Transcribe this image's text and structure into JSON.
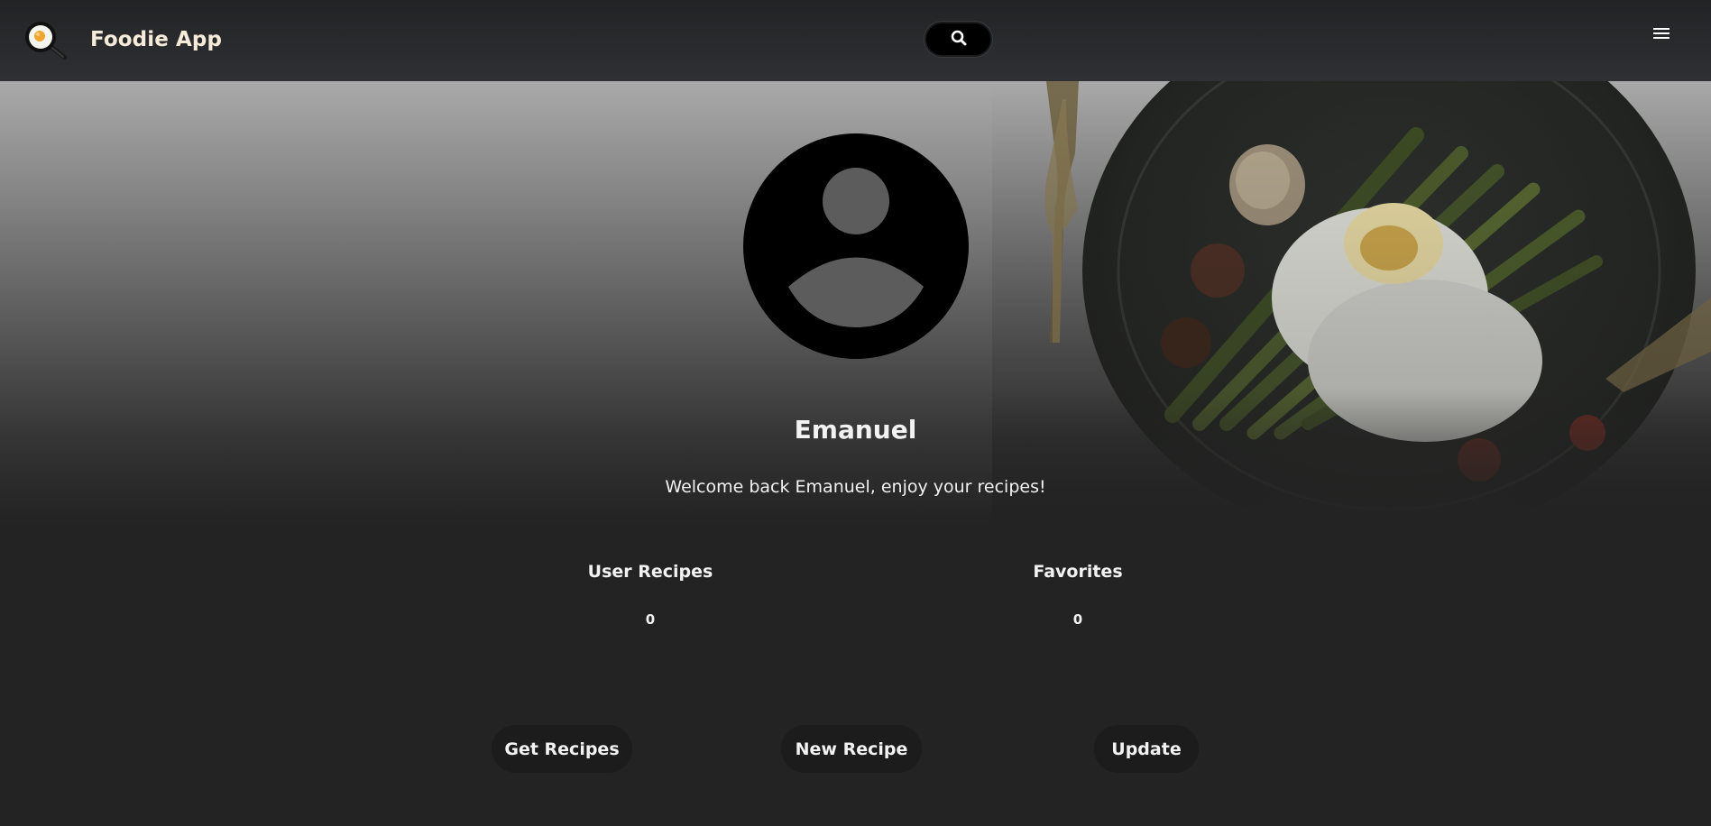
{
  "navbar": {
    "brand": "Foodie App",
    "logo_icon": "frying-pan-egg-icon",
    "search_icon": "search-icon",
    "menu_icon": "hamburger-menu-icon"
  },
  "profile": {
    "avatar_icon": "user-avatar-icon",
    "name": "Emanuel",
    "welcome": "Welcome back Emanuel, enjoy your recipes!"
  },
  "stats": {
    "user_recipes_label": "User Recipes",
    "user_recipes_value": "0",
    "favorites_label": "Favorites",
    "favorites_value": "0"
  },
  "actions": {
    "get_recipes": "Get Recipes",
    "new_recipe": "New Recipe",
    "update": "Update"
  },
  "colors": {
    "page_bg": "#232323",
    "navbar_bg": "#2f3033",
    "brand_text": "#f6ead9",
    "button_bg": "#1c1c1c"
  }
}
